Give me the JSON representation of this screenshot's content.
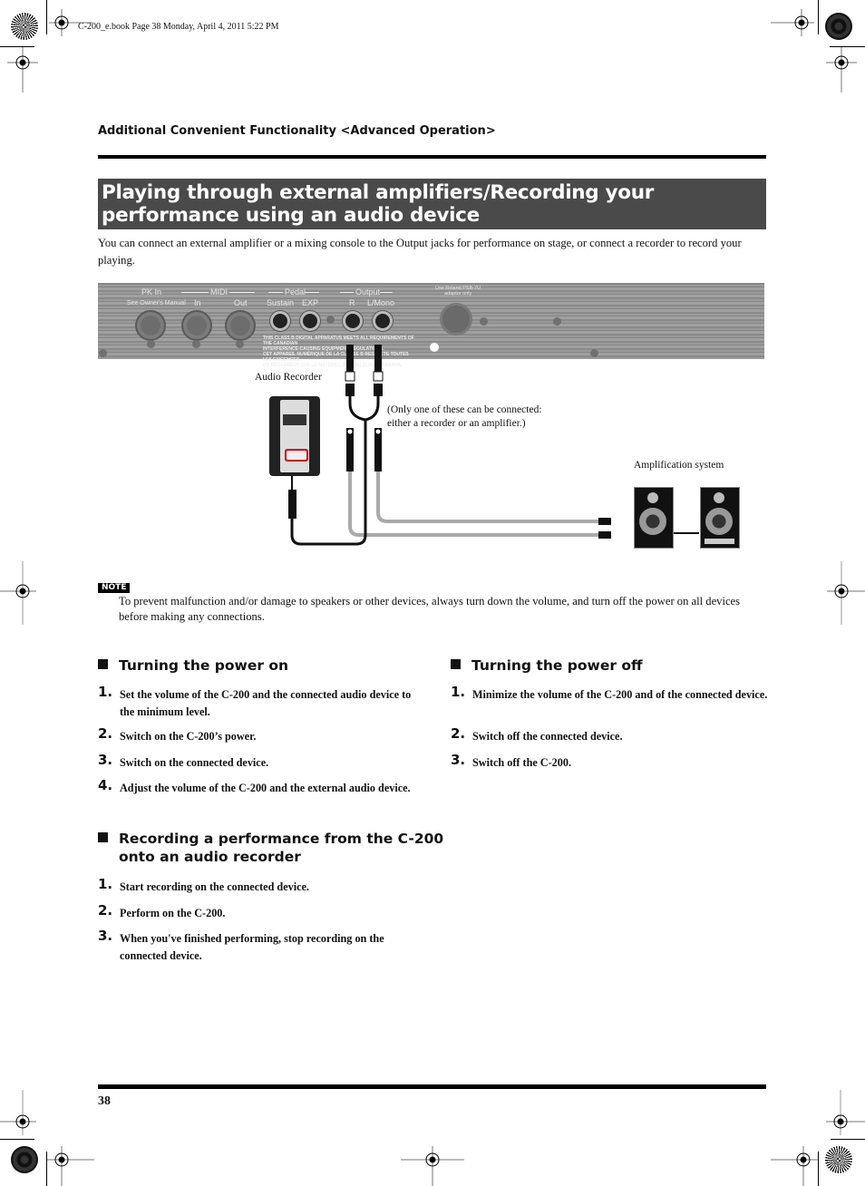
{
  "file_info": "C-200_e.book  Page 38  Monday, April 4, 2011  5:22 PM",
  "running_head": "Additional Convenient Functionality <Advanced Operation>",
  "title": "Playing through external amplifiers/Recording your performance using an audio device",
  "intro": "You can connect an external amplifier or a mixing console to the Output jacks for performance on stage, or connect a recorder to record your playing.",
  "diagram": {
    "panel": {
      "pk_in": "PK In",
      "pk_in_sub": "See Owner's Manual",
      "midi": "MIDI",
      "midi_in": "In",
      "midi_out": "Out",
      "pedal": "Pedal",
      "sustain": "Sustain",
      "exp": "EXP",
      "output": "Output",
      "out_r": "R",
      "out_l": "L/Mono",
      "adapter_line1": "Use Roland PSB-7U",
      "adapter_line2": "adaptor only",
      "compliance_1": "THIS CLASS B DIGITAL APPARATUS MEETS ALL REQUIREMENTS OF THE CANADIAN",
      "compliance_2": "INTERFERENCE-CAUSING EQUIPMENT REGULATIONS.",
      "compliance_3": "CET APPAREIL NUMÉRIQUE DE LA CLASSE B RESPECTE TOUTES LES EXIGENCES",
      "compliance_4": "DU RÈGLEMENT SUR LE MATÉRIEL BROUILLEUR DU CANADA."
    },
    "audio_recorder_label": "Audio Recorder",
    "only_one_note_line1": "(Only one of these can be connected:",
    "only_one_note_line2": "either a recorder or an amplifier.)",
    "amplification_label": "Amplification system"
  },
  "note": {
    "badge": "NOTE",
    "text": "To prevent malfunction and/or damage to speakers or other devices, always turn down the volume, and turn off the power on all devices before making any connections."
  },
  "sections": {
    "power_on": {
      "heading": "Turning the power on",
      "steps": [
        {
          "num": "1.",
          "text": "Set the volume of the C-200 and the connected audio device to the minimum level."
        },
        {
          "num": "2.",
          "text": "Switch on the C-200’s power."
        },
        {
          "num": "3.",
          "text": "Switch on the connected device."
        },
        {
          "num": "4.",
          "text": "Adjust the volume of the C-200 and the external audio device."
        }
      ]
    },
    "recording": {
      "heading_line1": "Recording a performance from the C-200",
      "heading_line2": "onto an audio recorder",
      "steps": [
        {
          "num": "1.",
          "text": "Start recording on the connected device."
        },
        {
          "num": "2.",
          "text": "Perform on the C-200."
        },
        {
          "num": "3.",
          "text": "When you've finished performing, stop recording on the connected device."
        }
      ]
    },
    "power_off": {
      "heading": "Turning the power off",
      "steps": [
        {
          "num": "1.",
          "text": "Minimize the volume of the C-200 and of the connected device."
        },
        {
          "num": "2.",
          "text": "Switch off the connected device."
        },
        {
          "num": "3.",
          "text": "Switch off the C-200."
        }
      ]
    }
  },
  "page_number": "38"
}
